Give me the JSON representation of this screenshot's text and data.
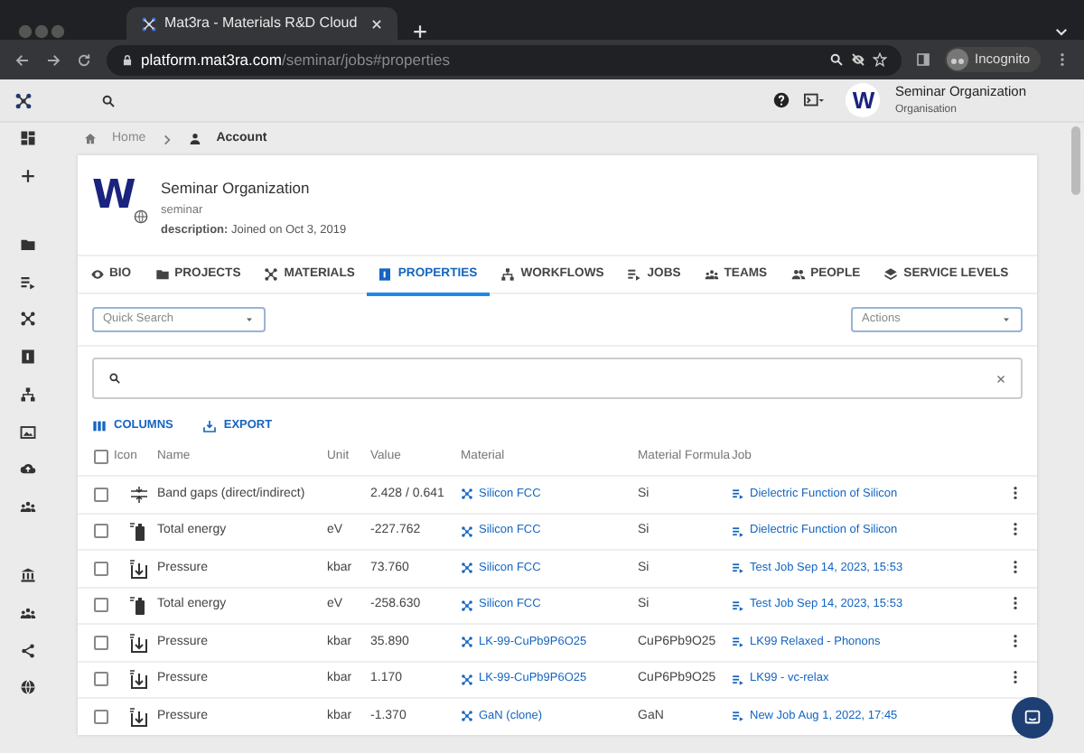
{
  "browser": {
    "tab_title": "Mat3ra - Materials R&D Cloud",
    "url_host": "platform.mat3ra.com",
    "url_path": "/seminar/jobs#properties",
    "profile_label": "Incognito"
  },
  "topbar": {
    "avatar_letter": "W",
    "org_name": "Seminar Organization",
    "org_role": "Organisation"
  },
  "breadcrumb": [
    "Home",
    "Account"
  ],
  "org": {
    "avatar_letter": "W",
    "name": "Seminar Organization",
    "slug": "seminar",
    "description": "**description:** Joined on Oct 3, 2019"
  },
  "tabs": [
    {
      "label": "BIO",
      "kind": "eye",
      "selected": false
    },
    {
      "label": "PROJECTS",
      "kind": "folder",
      "selected": false
    },
    {
      "label": "MATERIALS",
      "kind": "lattice",
      "selected": false
    },
    {
      "label": "PROPERTIES",
      "kind": "numbox",
      "selected": true
    },
    {
      "label": "WORKFLOWS",
      "kind": "tree",
      "selected": false
    },
    {
      "label": "JOBS",
      "kind": "list",
      "selected": false
    },
    {
      "label": "TEAMS",
      "kind": "group",
      "selected": false
    },
    {
      "label": "PEOPLE",
      "kind": "people",
      "selected": false
    },
    {
      "label": "SERVICE LEVELS",
      "kind": "layers",
      "selected": false
    }
  ],
  "quick_search": {
    "placeholder": "Quick Search"
  },
  "actions": {
    "placeholder": "Actions"
  },
  "toolbar": [
    "COLUMNS",
    "EXPORT"
  ],
  "table": {
    "header_checked": false,
    "columns": [
      "Icon",
      "Name",
      "Unit",
      "Value",
      "Material",
      "Material Formula",
      "Job"
    ],
    "rows": [
      {
        "checked": false,
        "kind": "bandgap",
        "name": "Band gaps (direct/indirect)",
        "unit": "",
        "value": "2.428 / 0.641",
        "material": "Silicon FCC",
        "formula": "Si",
        "job": "Dielectric Function of Silicon"
      },
      {
        "checked": false,
        "kind": "energy",
        "name": "Total energy",
        "unit": "eV",
        "value": "-227.762",
        "material": "Silicon FCC",
        "formula": "Si",
        "job": "Dielectric Function of Silicon"
      },
      {
        "checked": false,
        "kind": "pressure",
        "name": "Pressure",
        "unit": "kbar",
        "value": "73.760",
        "material": "Silicon FCC",
        "formula": "Si",
        "job": "Test Job Sep 14, 2023, 15:53"
      },
      {
        "checked": false,
        "kind": "energy",
        "name": "Total energy",
        "unit": "eV",
        "value": "-258.630",
        "material": "Silicon FCC",
        "formula": "Si",
        "job": "Test Job Sep 14, 2023, 15:53"
      },
      {
        "checked": false,
        "kind": "pressure",
        "name": "Pressure",
        "unit": "kbar",
        "value": "35.890",
        "material": "LK-99-CuPb9P6O25",
        "formula": "CuP6Pb9O25",
        "job": "LK99 Relaxed - Phonons"
      },
      {
        "checked": false,
        "kind": "pressure",
        "name": "Pressure",
        "unit": "kbar",
        "value": "1.170",
        "material": "LK-99-CuPb9P6O25",
        "formula": "CuP6Pb9O25",
        "job": "LK99 - vc-relax"
      },
      {
        "checked": false,
        "kind": "pressure",
        "name": "Pressure",
        "unit": "kbar",
        "value": "-1.370",
        "material": "GaN (clone)",
        "formula": "GaN",
        "job": "New Job Aug 1, 2022, 17:45"
      }
    ]
  }
}
